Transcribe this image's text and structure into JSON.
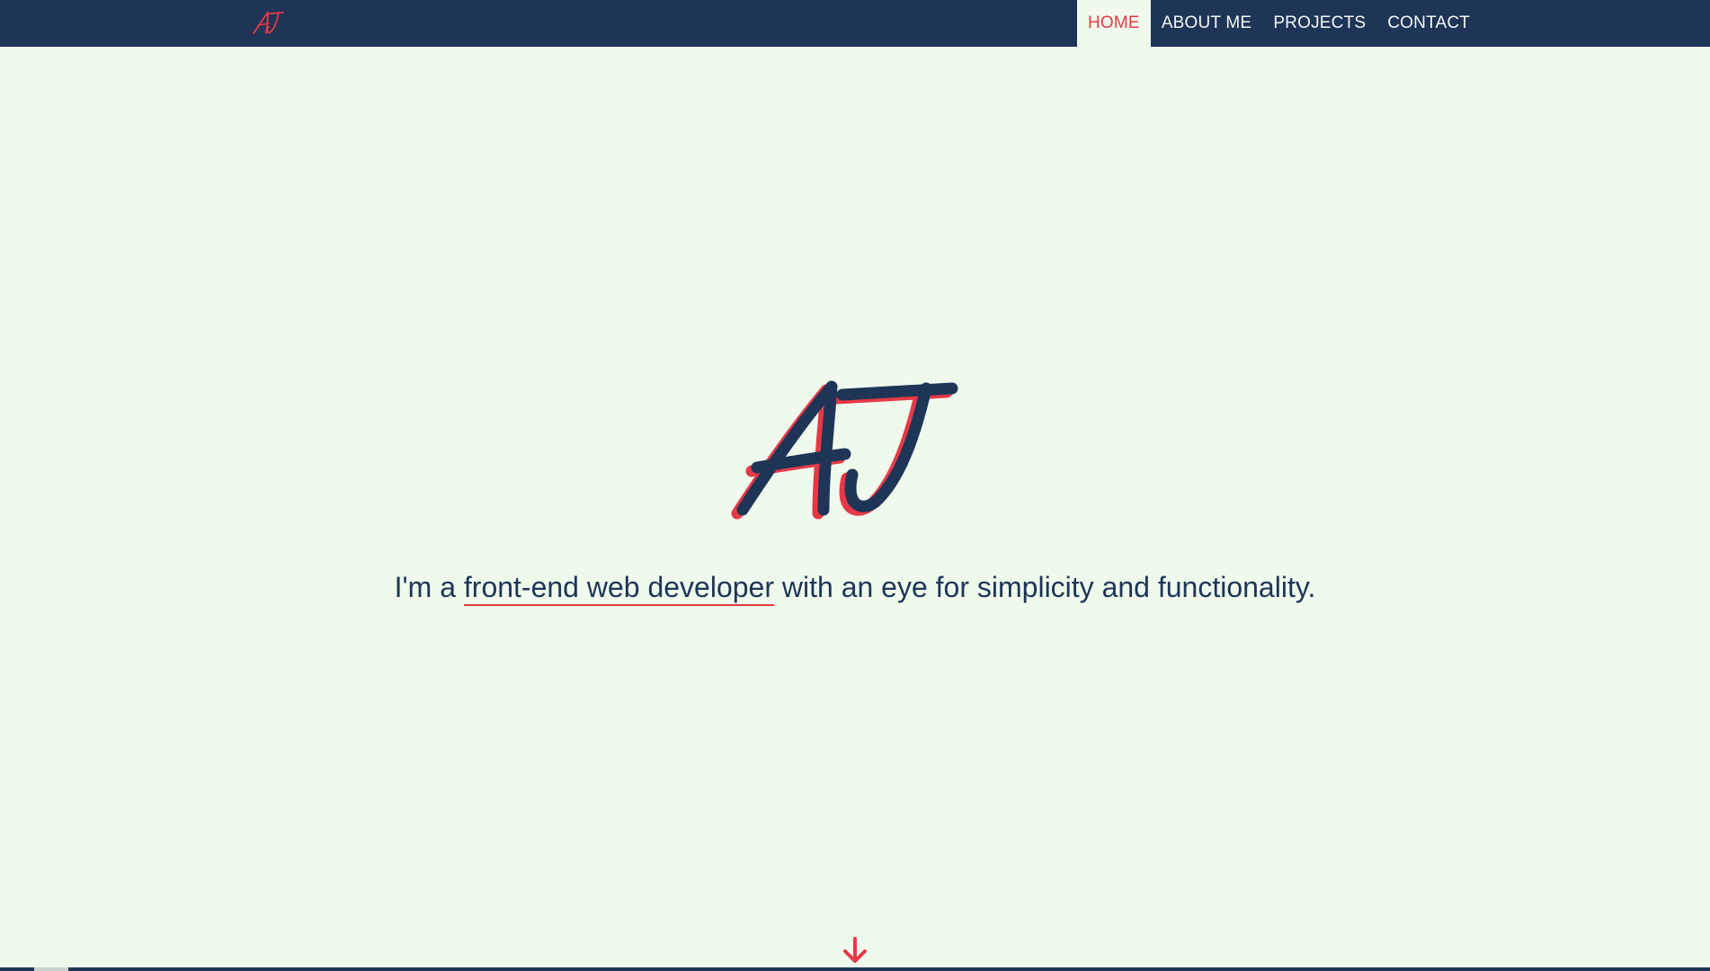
{
  "colors": {
    "navy": "#1e3557",
    "background": "#effaed",
    "accent": "#e63946",
    "nav_text": "#f4f8f4"
  },
  "header": {
    "logo_text": "AJ",
    "nav_links": [
      {
        "label": "HOME",
        "active": true
      },
      {
        "label": "ABOUT ME",
        "active": false
      },
      {
        "label": "PROJECTS",
        "active": false
      },
      {
        "label": "CONTACT",
        "active": false
      }
    ]
  },
  "hero": {
    "logo_text": "AJ",
    "tagline_prefix": "I'm a ",
    "tagline_highlight": "front-end web developer",
    "tagline_suffix": " with an eye for simplicity and functionality.",
    "scroll_icon": "arrow-down-icon"
  }
}
